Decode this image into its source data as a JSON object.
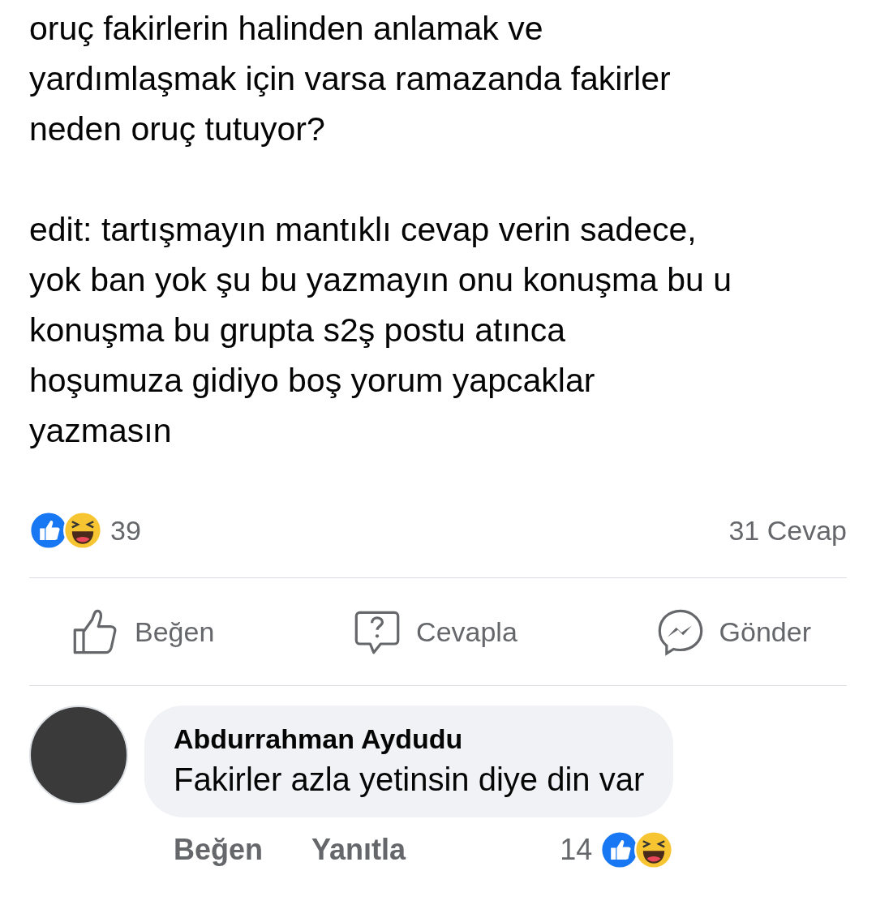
{
  "post": {
    "paragraphs": [
      "oruç fakirlerin halinden anlamak ve\nyardımlaşmak için varsa ramazanda fakirler\nneden oruç tutuyor?",
      "edit: tartışmayın mantıklı cevap verin sadece,\nyok ban yok şu bu yazmayın onu konuşma bu u\nkonuşma bu grupta s2ş postu atınca\nhoşumuza gidiyo boş yorum yapcaklar\nyazmasın"
    ],
    "reaction_count": "39",
    "reply_count": "31 Cevap"
  },
  "actions": [
    {
      "label": "Beğen",
      "kind": "like"
    },
    {
      "label": "Cevapla",
      "kind": "reply"
    },
    {
      "label": "Gönder",
      "kind": "send"
    }
  ],
  "comment": {
    "author": "Abdurrahman Aydudu",
    "text": "Fakirler azla yetinsin diye din var",
    "actions": [
      "Beğen",
      "Yanıtla"
    ],
    "reaction_count": "14"
  }
}
